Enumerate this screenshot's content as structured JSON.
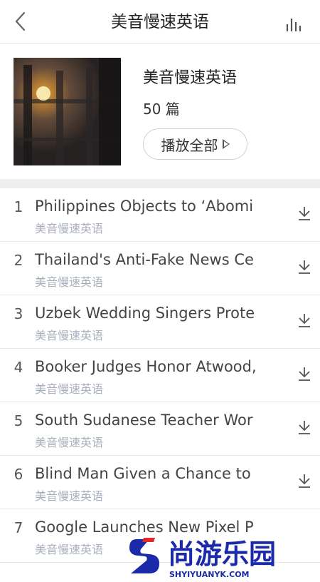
{
  "nav": {
    "title": "美音慢速英语",
    "back_icon": "back-chevron-icon",
    "bars_icon": "audio-bars-icon"
  },
  "album": {
    "title": "美音慢速英语",
    "count": "50 篇",
    "play_all_label": "播放全部"
  },
  "episodes": [
    {
      "num": "1",
      "title": "Philippines Objects to ‘Abomi",
      "subtitle": "美音慢速英语"
    },
    {
      "num": "2",
      "title": "Thailand's Anti-Fake News Ce",
      "subtitle": "美音慢速英语"
    },
    {
      "num": "3",
      "title": "Uzbek Wedding Singers Prote",
      "subtitle": "美音慢速英语"
    },
    {
      "num": "4",
      "title": "Booker Judges Honor Atwood,",
      "subtitle": "美音慢速英语"
    },
    {
      "num": "5",
      "title": "South Sudanese Teacher Wor",
      "subtitle": "美音慢速英语"
    },
    {
      "num": "6",
      "title": "Blind Man Given a Chance to",
      "subtitle": "美音慢速英语"
    },
    {
      "num": "7",
      "title": "Google Launches New Pixel P",
      "subtitle": "美音慢速英语"
    }
  ],
  "watermark": {
    "brand": "尚游乐园",
    "url": "SHYIYUANYK.COM"
  }
}
